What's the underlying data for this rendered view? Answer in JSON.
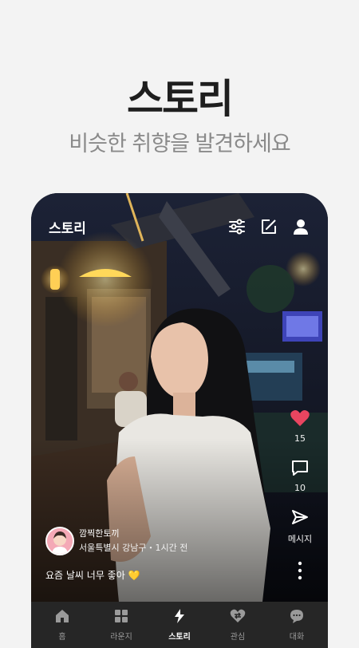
{
  "hero": {
    "title": "스토리",
    "subtitle": "비슷한 취향을 발견하세요"
  },
  "header": {
    "title": "스토리",
    "icons": [
      "filter-sliders-icon",
      "edit-icon",
      "profile-icon"
    ]
  },
  "post": {
    "likes": "15",
    "comments": "10",
    "message_label": "메시지",
    "author_name": "깜찍한토끼",
    "location_time": "서울특별시 강남구・1시간 전",
    "caption": "요즘 날씨 너무 좋아 💛",
    "like_color": "#e94560"
  },
  "tabs": [
    {
      "label": "홈",
      "icon": "home-icon"
    },
    {
      "label": "라운지",
      "icon": "grid-icon"
    },
    {
      "label": "스토리",
      "icon": "lightning-icon",
      "active": true
    },
    {
      "label": "관심",
      "icon": "heart-exchange-icon"
    },
    {
      "label": "대화",
      "icon": "chat-bubble-icon"
    }
  ]
}
